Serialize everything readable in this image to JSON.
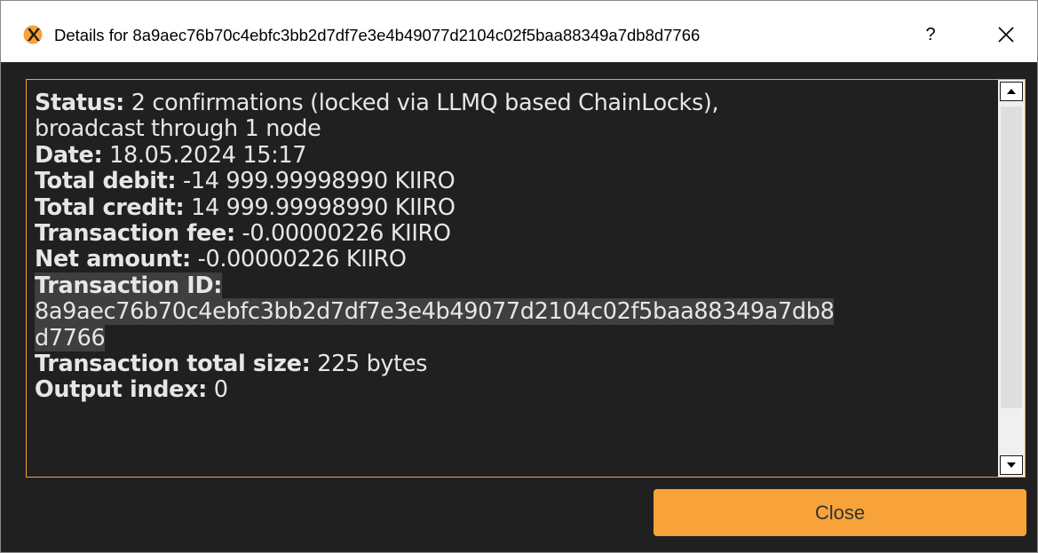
{
  "window": {
    "title": "Details for 8a9aec76b70c4ebfc3bb2d7df7e3e4b49077d2104c02f5baa88349a7db8d7766",
    "help_label": "?",
    "icon": "kiiro-logo-icon"
  },
  "details": {
    "status_label": "Status:",
    "status_value": " 2 confirmations (locked via LLMQ based ChainLocks),",
    "status_value_cont": "broadcast through 1 node",
    "date_label": "Date:",
    "date_value": " 18.05.2024 15:17",
    "total_debit_label": "Total debit:",
    "total_debit_value": " -14 999.99998990 KIIRO",
    "total_credit_label": "Total credit:",
    "total_credit_value": " 14 999.99998990 KIIRO",
    "fee_label": "Transaction fee:",
    "fee_value": " -0.00000226 KIIRO",
    "net_label": "Net amount:",
    "net_value": " -0.00000226 KIIRO",
    "txid_label": "Transaction ID:",
    "txid_line1": "8a9aec76b70c4ebfc3bb2d7df7e3e4b49077d2104c02f5baa88349a7db8",
    "txid_line2": "d7766",
    "size_label": "Transaction total size:",
    "size_value": " 225 bytes",
    "output_label": "Output index:",
    "output_value": " 0"
  },
  "buttons": {
    "close_label": "Close"
  },
  "colors": {
    "accent": "#f7a33a",
    "border_accent": "#f4a12a",
    "background": "#202020",
    "text": "#e6e6e6"
  }
}
